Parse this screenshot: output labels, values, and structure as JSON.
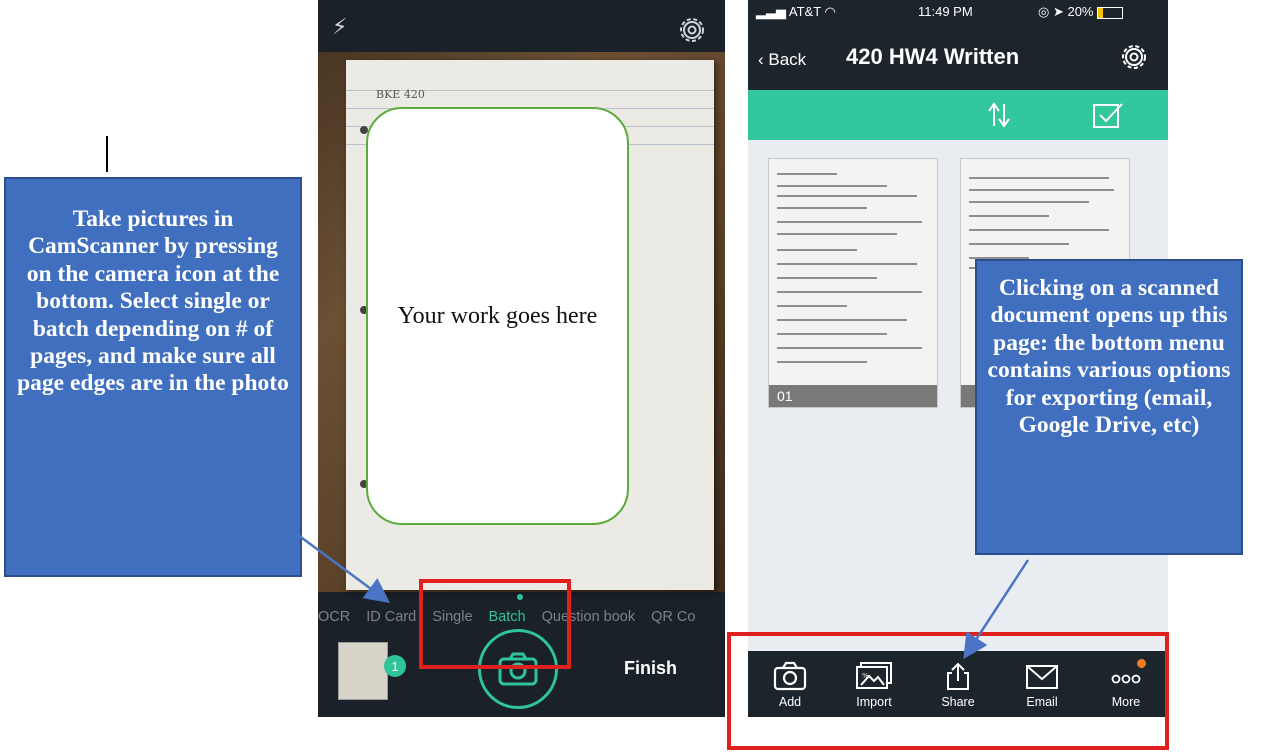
{
  "callouts": {
    "left": "Take pictures in CamScanner by pressing on the camera icon at the bottom. Select single or batch depending on # of pages, and make sure all page edges are in the photo",
    "right": "Clicking on a scanned document opens up this page: the bottom menu contains various options for exporting (email, Google Drive, etc)"
  },
  "camera_screen": {
    "placeholder_text": "Your work goes here",
    "modes": [
      "OCR",
      "ID Card",
      "Single",
      "Batch",
      "Question book",
      "QR Co"
    ],
    "active_mode": "Batch",
    "thumbnail_badge": "1",
    "finish_label": "Finish",
    "paper_note": "BKE 420"
  },
  "document_screen": {
    "status": {
      "carrier": "AT&T",
      "time": "11:49 PM",
      "battery": "20%"
    },
    "back_label": "Back",
    "title": "420 HW4 Written",
    "page_number": "01",
    "menu": [
      {
        "label": "Add",
        "icon": "camera-icon"
      },
      {
        "label": "Import",
        "icon": "image-import-icon"
      },
      {
        "label": "Share",
        "icon": "share-icon"
      },
      {
        "label": "Email",
        "icon": "envelope-icon"
      },
      {
        "label": "More",
        "icon": "more-dots-icon"
      }
    ]
  },
  "colors": {
    "callout_blue": "#3f6fbe",
    "accent_green": "#33c79d",
    "highlight_red": "#e0201f",
    "phone_dark": "#1c242c"
  }
}
